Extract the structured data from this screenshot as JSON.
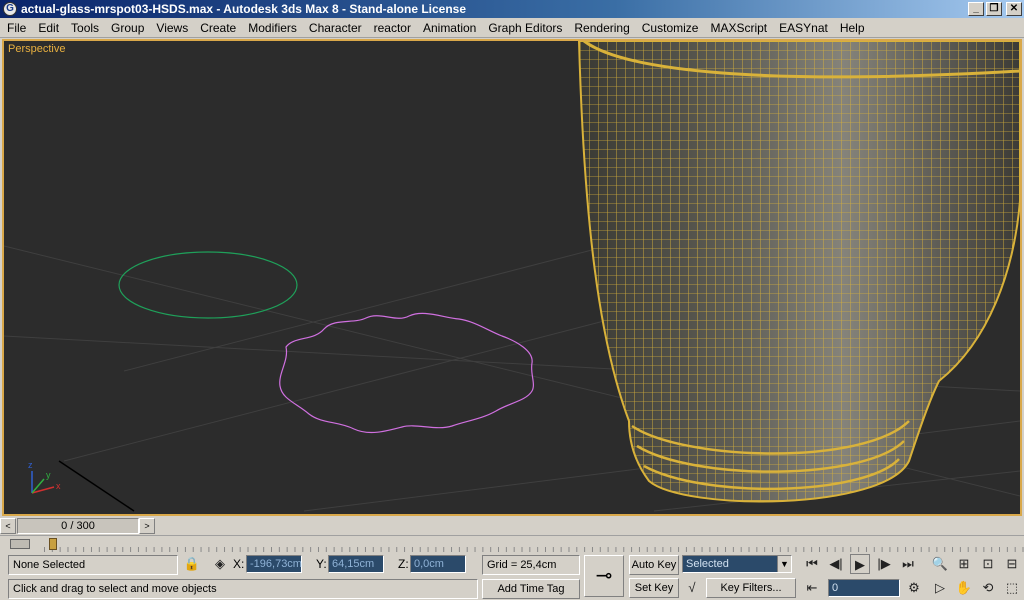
{
  "window": {
    "title": "actual-glass-mrspot03-HSDS.max - Autodesk 3ds Max 8  - Stand-alone License",
    "app_icon_glyph": "G",
    "min_glyph": "_",
    "restore_glyph": "❐",
    "close_glyph": "✕"
  },
  "menu": [
    "File",
    "Edit",
    "Tools",
    "Group",
    "Views",
    "Create",
    "Modifiers",
    "Character",
    "reactor",
    "Animation",
    "Graph Editors",
    "Rendering",
    "Customize",
    "MAXScript",
    "EASYnat",
    "Help"
  ],
  "viewport": {
    "label": "Perspective",
    "axes": {
      "x": "x",
      "y": "y",
      "z": "z"
    },
    "colors": {
      "background": "#2c2c2c",
      "border": "#d9a84a",
      "wireframe": "#d9b23a",
      "circle": "#1fa05a",
      "star_spline": "#d070e0"
    }
  },
  "time_slider": {
    "label": "0 / 300",
    "prev_glyph": "<",
    "next_glyph": ">"
  },
  "status": {
    "selection": "None Selected",
    "prompt": "Click and drag to select and move objects",
    "x_label": "X:",
    "x_value": "-196,73cm",
    "y_label": "Y:",
    "y_value": "64,15cm",
    "z_label": "Z:",
    "z_value": "0,0cm",
    "grid": "Grid = 25,4cm",
    "add_time_tag": "Add Time Tag",
    "auto_key": "Auto Key",
    "set_key": "Set Key",
    "key_mode": "Selected",
    "key_filters": "Key Filters...",
    "frame": "0",
    "dd_arrow": "▼"
  },
  "icons": {
    "lock": "🔒",
    "abs_mode": "◈",
    "key": "⊸",
    "goto_start": "⏮",
    "prev_frame": "◀|",
    "play": "▶",
    "next_frame": "|▶",
    "goto_end": "⏭",
    "time_config": "⚙",
    "key_mode_toggle": "⇤",
    "tangent": "√",
    "zoom": "🔍",
    "zoom_all": "⊞",
    "zoom_extents": "⊡",
    "zoom_extents_all": "⊟",
    "fov": "▷",
    "pan": "✋",
    "orbit": "⟲",
    "maximize": "⬚"
  }
}
